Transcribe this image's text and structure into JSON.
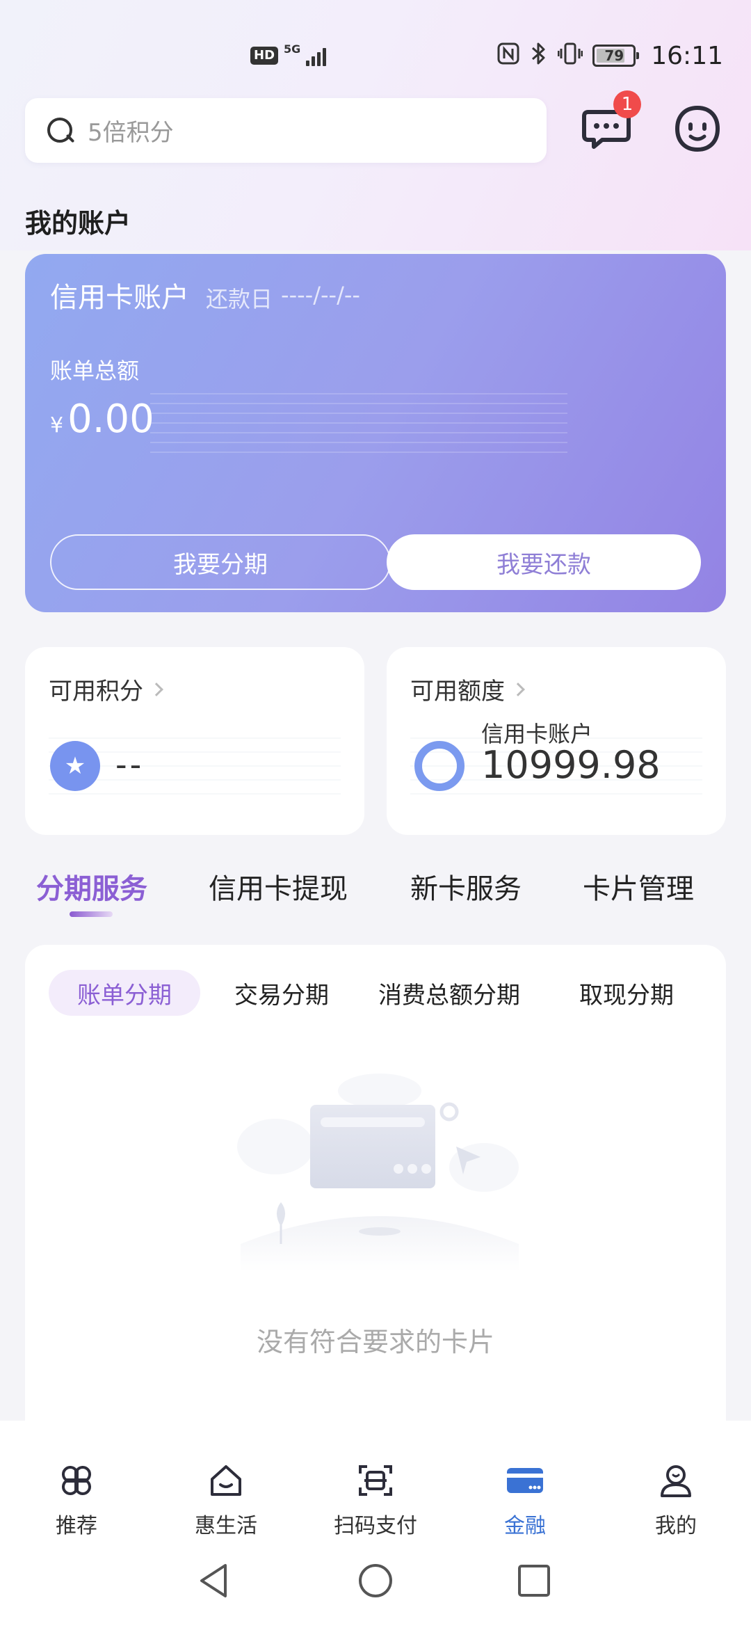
{
  "status_bar": {
    "hd": "HD",
    "network": "5G",
    "battery": "79",
    "battery_level": 0.79,
    "time": "16:11"
  },
  "search": {
    "placeholder": "5倍积分",
    "icon": "search-icon"
  },
  "header": {
    "message_badge": "1",
    "message_icon": "chat-bubble-icon",
    "service_icon": "smiley-face-icon"
  },
  "account_section_title": "我的账户",
  "credit_card": {
    "title": "信用卡账户",
    "due_label": "还款日",
    "due_date": "----/--/--",
    "bill_label": "账单总额",
    "currency": "¥",
    "amount": "0.00",
    "installment_button": "我要分期",
    "repay_button": "我要还款",
    "gradient_start": "#92a9f0",
    "gradient_end": "#9383e4"
  },
  "points_card": {
    "title": "可用积分",
    "value": "--",
    "icon": "star-icon"
  },
  "limit_card": {
    "title": "可用额度",
    "account_label": "信用卡账户",
    "value": "10999.98",
    "icon": "ring-icon"
  },
  "service_tabs": [
    {
      "label": "分期服务",
      "active": true
    },
    {
      "label": "信用卡提现",
      "active": false
    },
    {
      "label": "新卡服务",
      "active": false
    },
    {
      "label": "卡片管理",
      "active": false
    }
  ],
  "sub_tabs": [
    {
      "label": "账单分期",
      "active": true
    },
    {
      "label": "交易分期",
      "active": false
    },
    {
      "label": "消费总额分期",
      "active": false
    },
    {
      "label": "取现分期",
      "active": false
    }
  ],
  "empty_state": {
    "text": "没有符合要求的卡片",
    "illustration": "card-placeholder-illustration"
  },
  "bottom_nav": [
    {
      "label": "推荐",
      "icon": "grid-petals-icon",
      "active": false
    },
    {
      "label": "惠生活",
      "icon": "house-smile-icon",
      "active": false
    },
    {
      "label": "扫码支付",
      "icon": "scan-icon",
      "active": false
    },
    {
      "label": "金融",
      "icon": "bank-card-icon",
      "active": true
    },
    {
      "label": "我的",
      "icon": "person-icon",
      "active": false
    }
  ],
  "colors": {
    "accent_purple": "#8b5fd4",
    "active_nav_blue": "#3a72d4",
    "badge_red": "#f04b4b"
  }
}
